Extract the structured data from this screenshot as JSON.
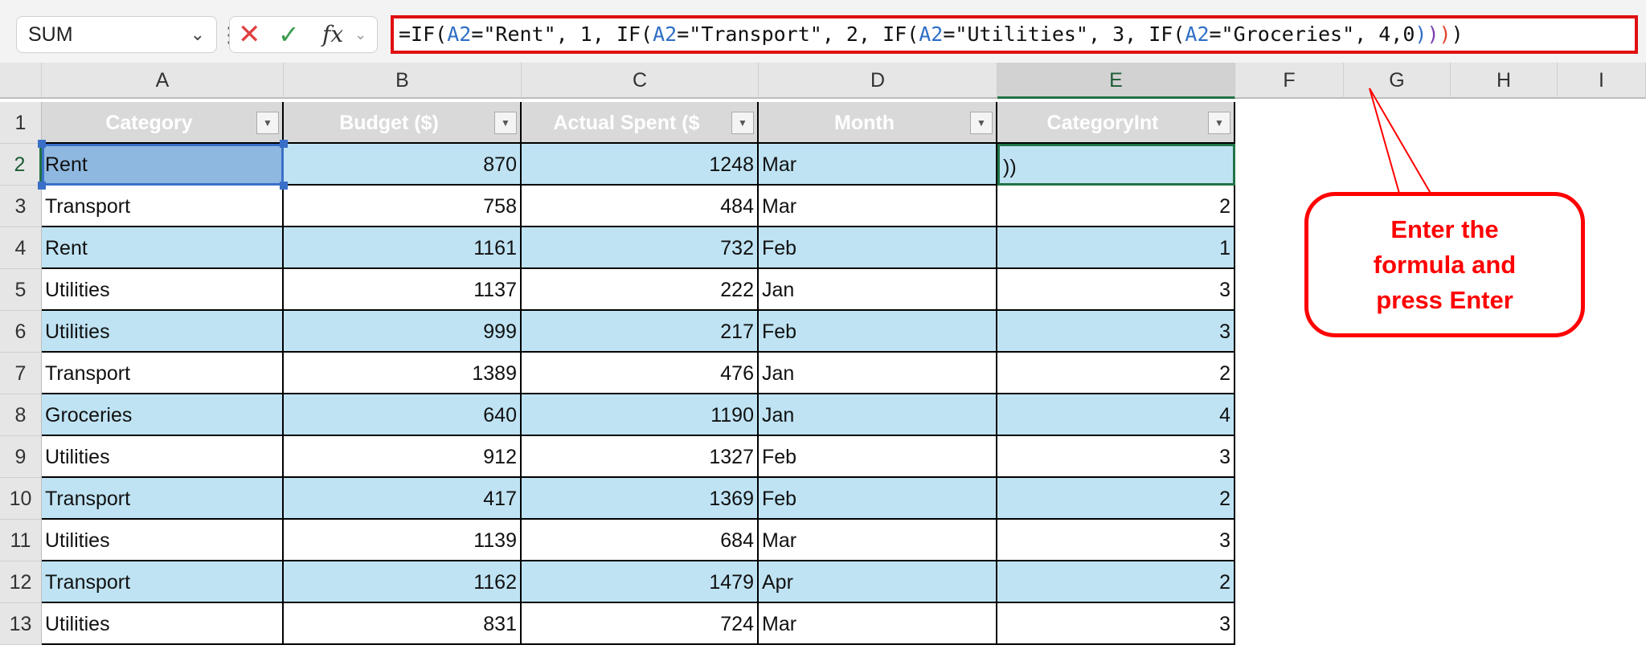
{
  "formula_bar": {
    "name_box": "SUM",
    "cancel_icon": "x-icon",
    "enter_icon": "check-icon",
    "fx_label": "fx",
    "formula_parts": [
      "=IF(",
      "A2",
      "=\"Rent\", 1, IF(",
      "A2",
      "=\"Transport\", 2, IF(",
      "A2",
      "=\"Utilities\", 3, IF(",
      "A2",
      "=\"Groceries\", 4,0",
      ")",
      ")",
      ")",
      ")"
    ]
  },
  "columns": [
    "A",
    "B",
    "C",
    "D",
    "E",
    "F",
    "G",
    "H",
    "I"
  ],
  "table": {
    "headers": [
      "Category",
      "Budget ($)",
      "Actual Spent ($",
      "Month",
      "CategoryInt"
    ],
    "rows": [
      [
        "Rent",
        "870",
        "1248",
        "Mar",
        "))"
      ],
      [
        "Transport",
        "758",
        "484",
        "Mar",
        "2"
      ],
      [
        "Rent",
        "1161",
        "732",
        "Feb",
        "1"
      ],
      [
        "Utilities",
        "1137",
        "222",
        "Jan",
        "3"
      ],
      [
        "Utilities",
        "999",
        "217",
        "Feb",
        "3"
      ],
      [
        "Transport",
        "1389",
        "476",
        "Jan",
        "2"
      ],
      [
        "Groceries",
        "640",
        "1190",
        "Jan",
        "4"
      ],
      [
        "Utilities",
        "912",
        "1327",
        "Feb",
        "3"
      ],
      [
        "Transport",
        "417",
        "1369",
        "Feb",
        "2"
      ],
      [
        "Utilities",
        "1139",
        "684",
        "Mar",
        "3"
      ],
      [
        "Transport",
        "1162",
        "1479",
        "Apr",
        "2"
      ],
      [
        "Utilities",
        "831",
        "724",
        "Mar",
        "3"
      ]
    ]
  },
  "row_numbers": [
    "1",
    "2",
    "3",
    "4",
    "5",
    "6",
    "7",
    "8",
    "9",
    "10",
    "11",
    "12",
    "13"
  ],
  "callout": {
    "line1": "Enter the",
    "line2": "formula and",
    "line3": "press Enter"
  },
  "colors": {
    "band": "#bfe3f3",
    "callout": "#ff0000",
    "active_cell": "#217346"
  }
}
